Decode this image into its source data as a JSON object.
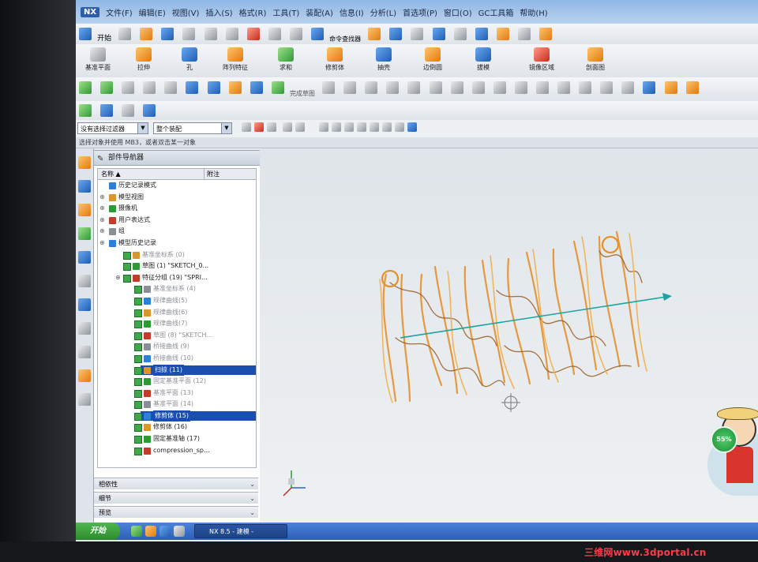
{
  "app": {
    "logo": "NX",
    "title": "NX 8.5 - 建模 - [...]"
  },
  "menu": [
    "文件(F)",
    "编辑(E)",
    "视图(V)",
    "插入(S)",
    "格式(R)",
    "工具(T)",
    "装配(A)",
    "信息(I)",
    "分析(L)",
    "首选项(P)",
    "窗口(O)",
    "GC工具箱",
    "帮助(H)"
  ],
  "toolbar1": {
    "start_label": "开始",
    "command_finder": "命令查找器"
  },
  "toolbar2": {
    "buttons": [
      "基准平面",
      "拉伸",
      "孔",
      "阵列特征",
      "求和",
      "修剪体",
      "抽壳",
      "边倒圆",
      "拔模",
      "镜像区域",
      "剖面图"
    ]
  },
  "toolbar3": {
    "sketch_label": "完成草图"
  },
  "selection": {
    "filter_value": "没有选择过滤器",
    "scope_value": "整个装配"
  },
  "status_text": "选择对象并使用 MB3，或者双击某一对象",
  "navigator": {
    "title": "部件导航器",
    "col_name": "名称",
    "col_attached": "附注",
    "rows": [
      {
        "label": "历史记录模式",
        "indent": 14,
        "dim": false
      },
      {
        "label": "模型视图",
        "indent": 14,
        "dim": false
      },
      {
        "label": "摄像机",
        "indent": 14,
        "dim": false
      },
      {
        "label": "用户表达式",
        "indent": 14,
        "dim": false
      },
      {
        "label": "组",
        "indent": 14,
        "dim": false
      },
      {
        "label": "模型历史记录",
        "indent": 14,
        "dim": false
      },
      {
        "label": "基准坐标系 (0)",
        "indent": 34,
        "dim": true
      },
      {
        "label": "草图 (1) \"SKETCH_0...",
        "indent": 34,
        "dim": false
      },
      {
        "label": "特征分组 (19) \"SPRI...",
        "indent": 34,
        "dim": false
      },
      {
        "label": "基准坐标系 (4)",
        "indent": 48,
        "dim": true
      },
      {
        "label": "规律曲线(5)",
        "indent": 48,
        "dim": true
      },
      {
        "label": "规律曲线(6)",
        "indent": 48,
        "dim": true
      },
      {
        "label": "规律曲线(7)",
        "indent": 48,
        "dim": true
      },
      {
        "label": "草图 (8) \"SKETCH...",
        "indent": 48,
        "dim": true
      },
      {
        "label": "桥接曲线 (9)",
        "indent": 48,
        "dim": true
      },
      {
        "label": "桥接曲线 (10)",
        "indent": 48,
        "dim": true
      },
      {
        "label": "扫掠 (11)",
        "indent": 48,
        "dim": false,
        "selected": true
      },
      {
        "label": "固定基准平面 (12)",
        "indent": 48,
        "dim": true
      },
      {
        "label": "基准平面 (13)",
        "indent": 48,
        "dim": true
      },
      {
        "label": "基准平面 (14)",
        "indent": 48,
        "dim": true
      },
      {
        "label": "修剪体 (15)",
        "indent": 48,
        "dim": false,
        "selected": true
      },
      {
        "label": "修剪体 (16)",
        "indent": 48,
        "dim": false
      },
      {
        "label": "固定基准轴 (17)",
        "indent": 48,
        "dim": false
      },
      {
        "label": "compression_sp...",
        "indent": 48,
        "dim": false
      }
    ],
    "panels": [
      "相依性",
      "细节",
      "预览"
    ]
  },
  "taskbar": {
    "start": "开始",
    "task": "NX 8.5 - 建模 -"
  },
  "widget": {
    "percent": "55%"
  },
  "watermark": "三维网www.3dportal.cn",
  "colors": {
    "spring": "#e08a2a",
    "axis": "#1aa3a0",
    "selection": "#1a4fb0"
  }
}
